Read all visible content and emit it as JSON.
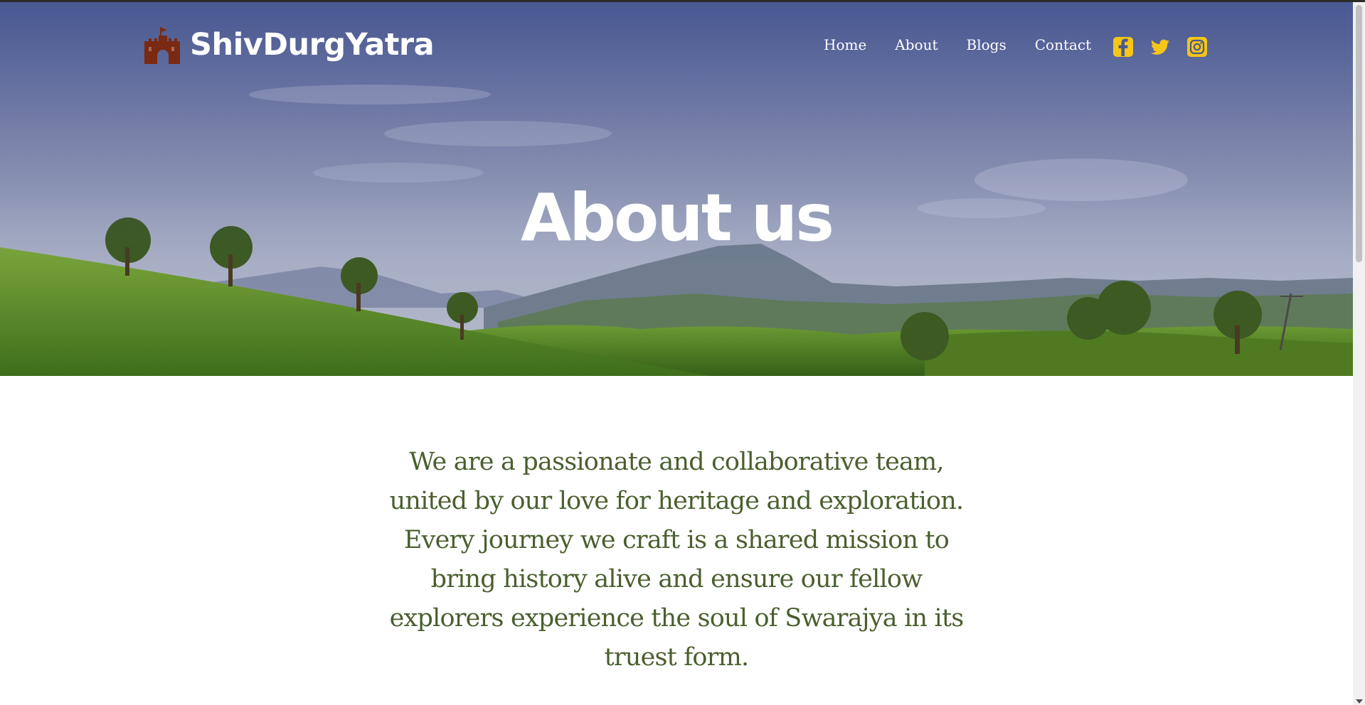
{
  "brand": {
    "name": "ShivDurgYatra",
    "logo_icon": "castle-icon",
    "logo_color": "#7a2a12"
  },
  "nav": {
    "links": [
      "Home",
      "About",
      "Blogs",
      "Contact"
    ]
  },
  "social": {
    "icons": [
      "facebook-icon",
      "twitter-icon",
      "instagram-icon"
    ],
    "color": "#f5c518"
  },
  "hero": {
    "title": "About us"
  },
  "intro": {
    "text": "We are a passionate and collaborative team, united by our love for heritage and exploration. Every journey we craft is a shared mission to bring history alive and ensure our fellow explorers experience the soul of Swarajya in its truest form.",
    "color": "#4a5f2e"
  }
}
